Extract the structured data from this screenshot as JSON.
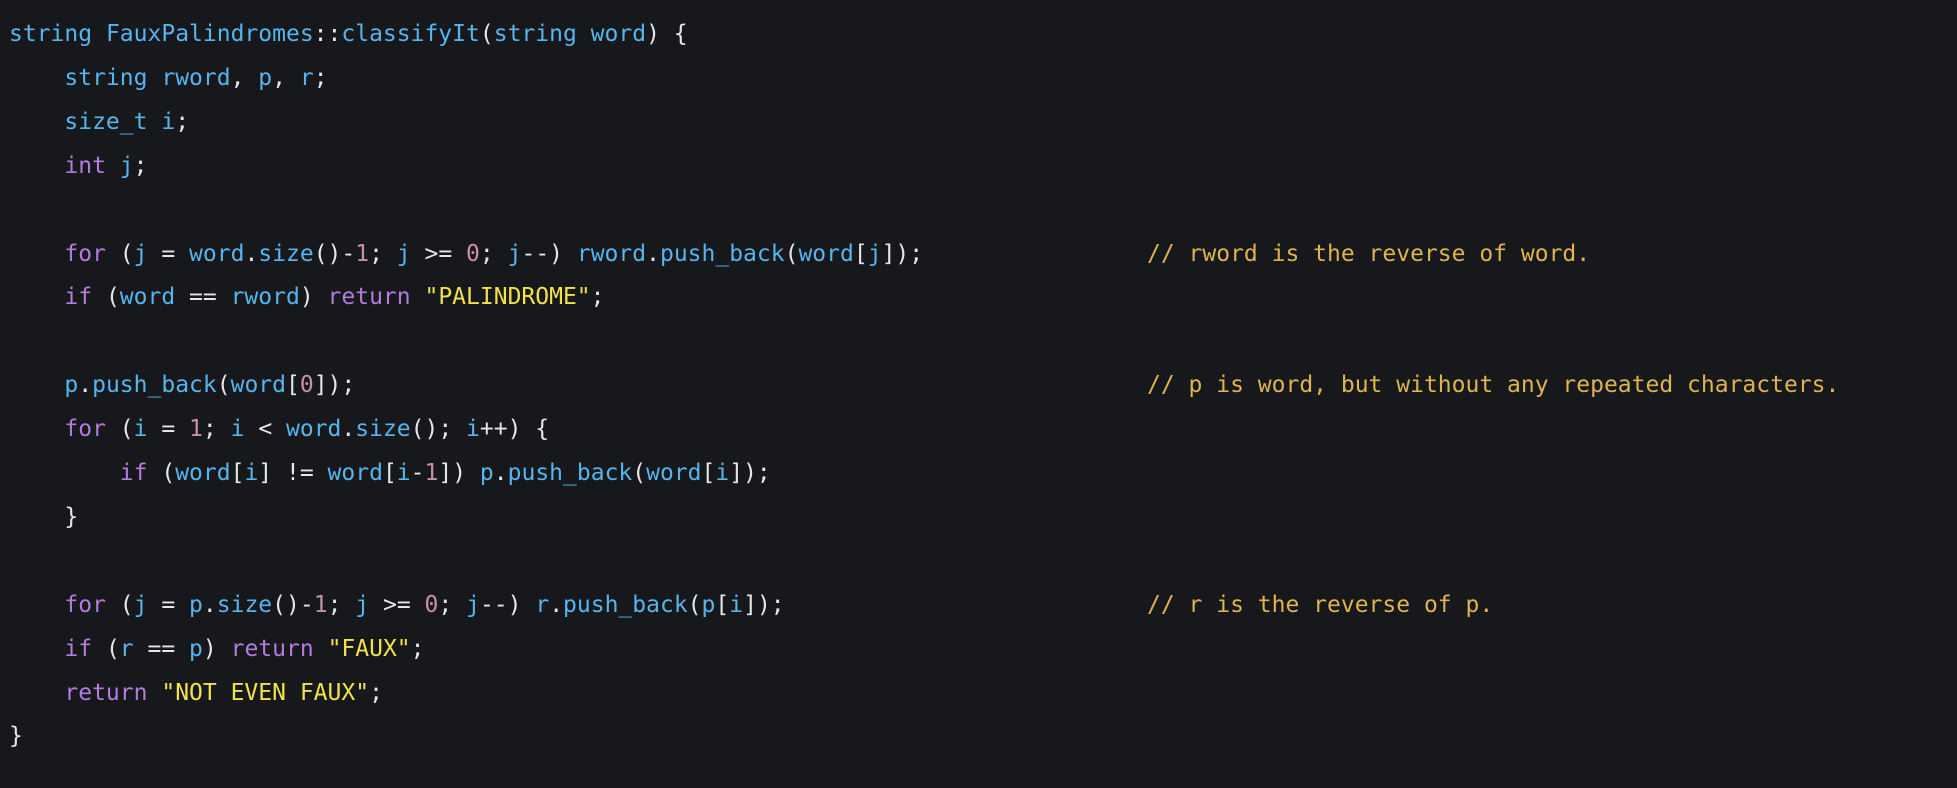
{
  "colors": {
    "background": "#17181b",
    "plain": "#e6e6e6",
    "keyword": "#b57ae0",
    "identifier": "#56b4ee",
    "type": "#56b4ee",
    "string": "#f2e24a",
    "number": "#c98fa6",
    "comment": "#dfb34e"
  },
  "editor": {
    "lines": [
      {
        "tokens": [
          {
            "t": "string",
            "k": "type"
          },
          {
            "t": " ",
            "k": "plain"
          },
          {
            "t": "FauxPalindromes",
            "k": "identifier"
          },
          {
            "t": "::",
            "k": "plain"
          },
          {
            "t": "classifyIt",
            "k": "identifier"
          },
          {
            "t": "(",
            "k": "plain"
          },
          {
            "t": "string",
            "k": "type"
          },
          {
            "t": " ",
            "k": "plain"
          },
          {
            "t": "word",
            "k": "identifier"
          },
          {
            "t": ") {",
            "k": "plain"
          }
        ]
      },
      {
        "tokens": [
          {
            "t": "    ",
            "k": "plain"
          },
          {
            "t": "string",
            "k": "type"
          },
          {
            "t": " ",
            "k": "plain"
          },
          {
            "t": "rword",
            "k": "identifier"
          },
          {
            "t": ", ",
            "k": "plain"
          },
          {
            "t": "p",
            "k": "identifier"
          },
          {
            "t": ", ",
            "k": "plain"
          },
          {
            "t": "r",
            "k": "identifier"
          },
          {
            "t": ";",
            "k": "plain"
          }
        ]
      },
      {
        "tokens": [
          {
            "t": "    ",
            "k": "plain"
          },
          {
            "t": "size_t",
            "k": "type"
          },
          {
            "t": " ",
            "k": "plain"
          },
          {
            "t": "i",
            "k": "identifier"
          },
          {
            "t": ";",
            "k": "plain"
          }
        ]
      },
      {
        "tokens": [
          {
            "t": "    ",
            "k": "plain"
          },
          {
            "t": "int",
            "k": "keyword"
          },
          {
            "t": " ",
            "k": "plain"
          },
          {
            "t": "j",
            "k": "identifier"
          },
          {
            "t": ";",
            "k": "plain"
          }
        ]
      },
      {
        "tokens": []
      },
      {
        "tokens": [
          {
            "t": "    ",
            "k": "plain"
          },
          {
            "t": "for",
            "k": "keyword"
          },
          {
            "t": " (",
            "k": "plain"
          },
          {
            "t": "j",
            "k": "identifier"
          },
          {
            "t": " = ",
            "k": "plain"
          },
          {
            "t": "word",
            "k": "identifier"
          },
          {
            "t": ".",
            "k": "plain"
          },
          {
            "t": "size",
            "k": "identifier"
          },
          {
            "t": "()-",
            "k": "plain"
          },
          {
            "t": "1",
            "k": "number"
          },
          {
            "t": "; ",
            "k": "plain"
          },
          {
            "t": "j",
            "k": "identifier"
          },
          {
            "t": " >= ",
            "k": "plain"
          },
          {
            "t": "0",
            "k": "number"
          },
          {
            "t": "; ",
            "k": "plain"
          },
          {
            "t": "j",
            "k": "identifier"
          },
          {
            "t": "--) ",
            "k": "plain"
          },
          {
            "t": "rword",
            "k": "identifier"
          },
          {
            "t": ".",
            "k": "plain"
          },
          {
            "t": "push_back",
            "k": "identifier"
          },
          {
            "t": "(",
            "k": "plain"
          },
          {
            "t": "word",
            "k": "identifier"
          },
          {
            "t": "[",
            "k": "plain"
          },
          {
            "t": "j",
            "k": "identifier"
          },
          {
            "t": "]);",
            "k": "plain"
          }
        ],
        "comment": "// rword is the reverse of word."
      },
      {
        "tokens": [
          {
            "t": "    ",
            "k": "plain"
          },
          {
            "t": "if",
            "k": "keyword"
          },
          {
            "t": " (",
            "k": "plain"
          },
          {
            "t": "word",
            "k": "identifier"
          },
          {
            "t": " == ",
            "k": "plain"
          },
          {
            "t": "rword",
            "k": "identifier"
          },
          {
            "t": ") ",
            "k": "plain"
          },
          {
            "t": "return",
            "k": "keyword"
          },
          {
            "t": " ",
            "k": "plain"
          },
          {
            "t": "\"PALINDROME\"",
            "k": "string"
          },
          {
            "t": ";",
            "k": "plain"
          }
        ]
      },
      {
        "tokens": []
      },
      {
        "tokens": [
          {
            "t": "    ",
            "k": "plain"
          },
          {
            "t": "p",
            "k": "identifier"
          },
          {
            "t": ".",
            "k": "plain"
          },
          {
            "t": "push_back",
            "k": "identifier"
          },
          {
            "t": "(",
            "k": "plain"
          },
          {
            "t": "word",
            "k": "identifier"
          },
          {
            "t": "[",
            "k": "plain"
          },
          {
            "t": "0",
            "k": "number"
          },
          {
            "t": "]);",
            "k": "plain"
          }
        ],
        "comment": "// p is word, but without any repeated characters."
      },
      {
        "tokens": [
          {
            "t": "    ",
            "k": "plain"
          },
          {
            "t": "for",
            "k": "keyword"
          },
          {
            "t": " (",
            "k": "plain"
          },
          {
            "t": "i",
            "k": "identifier"
          },
          {
            "t": " = ",
            "k": "plain"
          },
          {
            "t": "1",
            "k": "number"
          },
          {
            "t": "; ",
            "k": "plain"
          },
          {
            "t": "i",
            "k": "identifier"
          },
          {
            "t": " < ",
            "k": "plain"
          },
          {
            "t": "word",
            "k": "identifier"
          },
          {
            "t": ".",
            "k": "plain"
          },
          {
            "t": "size",
            "k": "identifier"
          },
          {
            "t": "(); ",
            "k": "plain"
          },
          {
            "t": "i",
            "k": "identifier"
          },
          {
            "t": "++) {",
            "k": "plain"
          }
        ]
      },
      {
        "tokens": [
          {
            "t": "        ",
            "k": "plain"
          },
          {
            "t": "if",
            "k": "keyword"
          },
          {
            "t": " (",
            "k": "plain"
          },
          {
            "t": "word",
            "k": "identifier"
          },
          {
            "t": "[",
            "k": "plain"
          },
          {
            "t": "i",
            "k": "identifier"
          },
          {
            "t": "] != ",
            "k": "plain"
          },
          {
            "t": "word",
            "k": "identifier"
          },
          {
            "t": "[",
            "k": "plain"
          },
          {
            "t": "i",
            "k": "identifier"
          },
          {
            "t": "-",
            "k": "plain"
          },
          {
            "t": "1",
            "k": "number"
          },
          {
            "t": "]) ",
            "k": "plain"
          },
          {
            "t": "p",
            "k": "identifier"
          },
          {
            "t": ".",
            "k": "plain"
          },
          {
            "t": "push_back",
            "k": "identifier"
          },
          {
            "t": "(",
            "k": "plain"
          },
          {
            "t": "word",
            "k": "identifier"
          },
          {
            "t": "[",
            "k": "plain"
          },
          {
            "t": "i",
            "k": "identifier"
          },
          {
            "t": "]);",
            "k": "plain"
          }
        ]
      },
      {
        "tokens": [
          {
            "t": "    }",
            "k": "plain"
          }
        ]
      },
      {
        "tokens": []
      },
      {
        "tokens": [
          {
            "t": "    ",
            "k": "plain"
          },
          {
            "t": "for",
            "k": "keyword"
          },
          {
            "t": " (",
            "k": "plain"
          },
          {
            "t": "j",
            "k": "identifier"
          },
          {
            "t": " = ",
            "k": "plain"
          },
          {
            "t": "p",
            "k": "identifier"
          },
          {
            "t": ".",
            "k": "plain"
          },
          {
            "t": "size",
            "k": "identifier"
          },
          {
            "t": "()-",
            "k": "plain"
          },
          {
            "t": "1",
            "k": "number"
          },
          {
            "t": "; ",
            "k": "plain"
          },
          {
            "t": "j",
            "k": "identifier"
          },
          {
            "t": " >= ",
            "k": "plain"
          },
          {
            "t": "0",
            "k": "number"
          },
          {
            "t": "; ",
            "k": "plain"
          },
          {
            "t": "j",
            "k": "identifier"
          },
          {
            "t": "--) ",
            "k": "plain"
          },
          {
            "t": "r",
            "k": "identifier"
          },
          {
            "t": ".",
            "k": "plain"
          },
          {
            "t": "push_back",
            "k": "identifier"
          },
          {
            "t": "(",
            "k": "plain"
          },
          {
            "t": "p",
            "k": "identifier"
          },
          {
            "t": "[",
            "k": "plain"
          },
          {
            "t": "i",
            "k": "identifier"
          },
          {
            "t": "]);",
            "k": "plain"
          }
        ],
        "comment": "// r is the reverse of p."
      },
      {
        "tokens": [
          {
            "t": "    ",
            "k": "plain"
          },
          {
            "t": "if",
            "k": "keyword"
          },
          {
            "t": " (",
            "k": "plain"
          },
          {
            "t": "r",
            "k": "identifier"
          },
          {
            "t": " == ",
            "k": "plain"
          },
          {
            "t": "p",
            "k": "identifier"
          },
          {
            "t": ") ",
            "k": "plain"
          },
          {
            "t": "return",
            "k": "keyword"
          },
          {
            "t": " ",
            "k": "plain"
          },
          {
            "t": "\"FAUX\"",
            "k": "string"
          },
          {
            "t": ";",
            "k": "plain"
          }
        ]
      },
      {
        "tokens": [
          {
            "t": "    ",
            "k": "plain"
          },
          {
            "t": "return",
            "k": "keyword"
          },
          {
            "t": " ",
            "k": "plain"
          },
          {
            "t": "\"NOT EVEN FAUX\"",
            "k": "string"
          },
          {
            "t": ";",
            "k": "plain"
          }
        ]
      },
      {
        "tokens": [
          {
            "t": "}",
            "k": "plain"
          }
        ]
      }
    ]
  }
}
